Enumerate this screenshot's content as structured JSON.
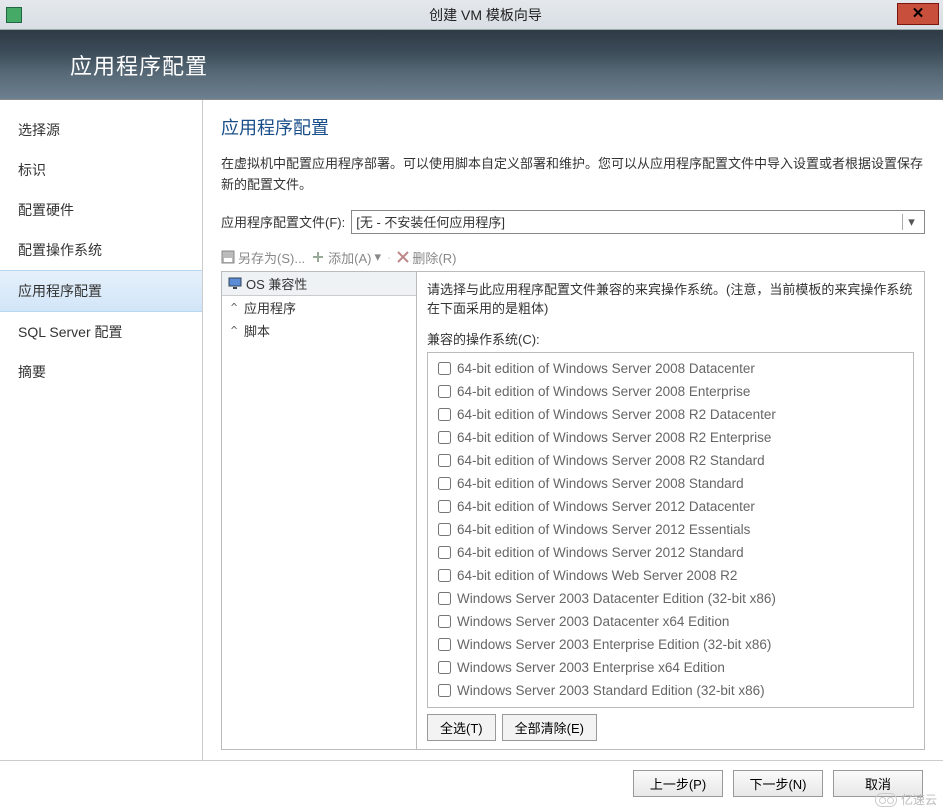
{
  "window": {
    "title": "创建 VM 模板向导"
  },
  "banner": {
    "title": "应用程序配置"
  },
  "sidebar": {
    "steps": [
      {
        "label": "选择源"
      },
      {
        "label": "标识"
      },
      {
        "label": "配置硬件"
      },
      {
        "label": "配置操作系统"
      },
      {
        "label": "应用程序配置",
        "active": true
      },
      {
        "label": "SQL Server 配置"
      },
      {
        "label": "摘要"
      }
    ]
  },
  "main": {
    "title": "应用程序配置",
    "description": "在虚拟机中配置应用程序部署。可以使用脚本自定义部署和维护。您可以从应用程序配置文件中导入设置或者根据设置保存新的配置文件。",
    "profile_label": "应用程序配置文件(F):",
    "profile_value": "[无 - 不安装任何应用程序]"
  },
  "toolbar": {
    "save_as": "另存为(S)...",
    "add": "添加(A)",
    "remove": "删除(R)"
  },
  "tree": {
    "header": "OS 兼容性",
    "items": [
      {
        "label": "应用程序"
      },
      {
        "label": "脚本"
      }
    ]
  },
  "rightpane": {
    "instruction": "请选择与此应用程序配置文件兼容的来宾操作系统。(注意，当前模板的来宾操作系统在下面采用的是粗体)",
    "os_label": "兼容的操作系统(C):",
    "os_list": [
      "64-bit edition of Windows Server 2008 Datacenter",
      "64-bit edition of Windows Server 2008 Enterprise",
      "64-bit edition of Windows Server 2008 R2 Datacenter",
      "64-bit edition of Windows Server 2008 R2 Enterprise",
      "64-bit edition of Windows Server 2008 R2 Standard",
      "64-bit edition of Windows Server 2008 Standard",
      "64-bit edition of Windows Server 2012 Datacenter",
      "64-bit edition of Windows Server 2012 Essentials",
      "64-bit edition of Windows Server 2012 Standard",
      "64-bit edition of Windows Web Server 2008 R2",
      "Windows Server 2003 Datacenter Edition (32-bit x86)",
      "Windows Server 2003 Datacenter x64 Edition",
      "Windows Server 2003 Enterprise Edition (32-bit x86)",
      "Windows Server 2003 Enterprise x64 Edition",
      "Windows Server 2003 Standard Edition (32-bit x86)"
    ],
    "select_all": "全选(T)",
    "clear_all": "全部清除(E)"
  },
  "footer": {
    "prev": "上一步(P)",
    "next": "下一步(N)",
    "cancel": "取消"
  },
  "watermark": "亿速云"
}
